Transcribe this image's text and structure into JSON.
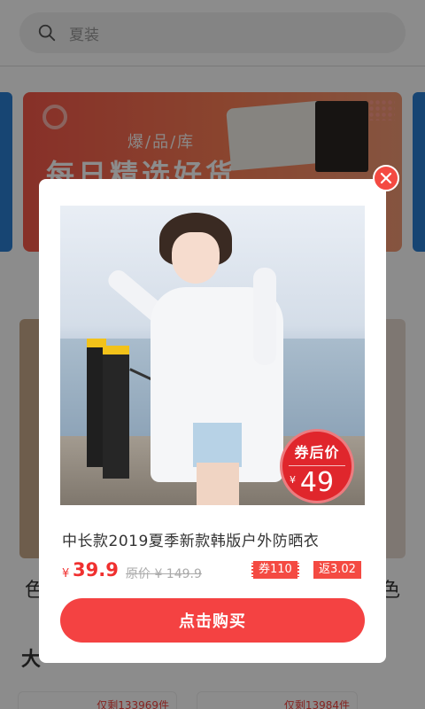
{
  "search": {
    "placeholder": "夏装"
  },
  "banner": {
    "subtitle": "爆/品/库",
    "headline": "每日精选好货"
  },
  "background": {
    "edge_text_left": "色",
    "edge_text_right": "色",
    "section_heading": "大",
    "cards": [
      {
        "stock": "仅剩133969件"
      },
      {
        "stock": "仅剩13984件"
      }
    ]
  },
  "modal": {
    "badge": {
      "label": "券后价",
      "currency": "¥",
      "price": "49"
    },
    "product_title": "中长款2019夏季新款韩版户外防晒衣",
    "price_currency": "¥",
    "price": "39.9",
    "original_price": "原价 ¥ 149.9",
    "coupon": "券110",
    "rebate": "返3.02",
    "buy_button": "点击购买"
  },
  "colors": {
    "accent": "#f44242",
    "badge": "#e0262c"
  }
}
